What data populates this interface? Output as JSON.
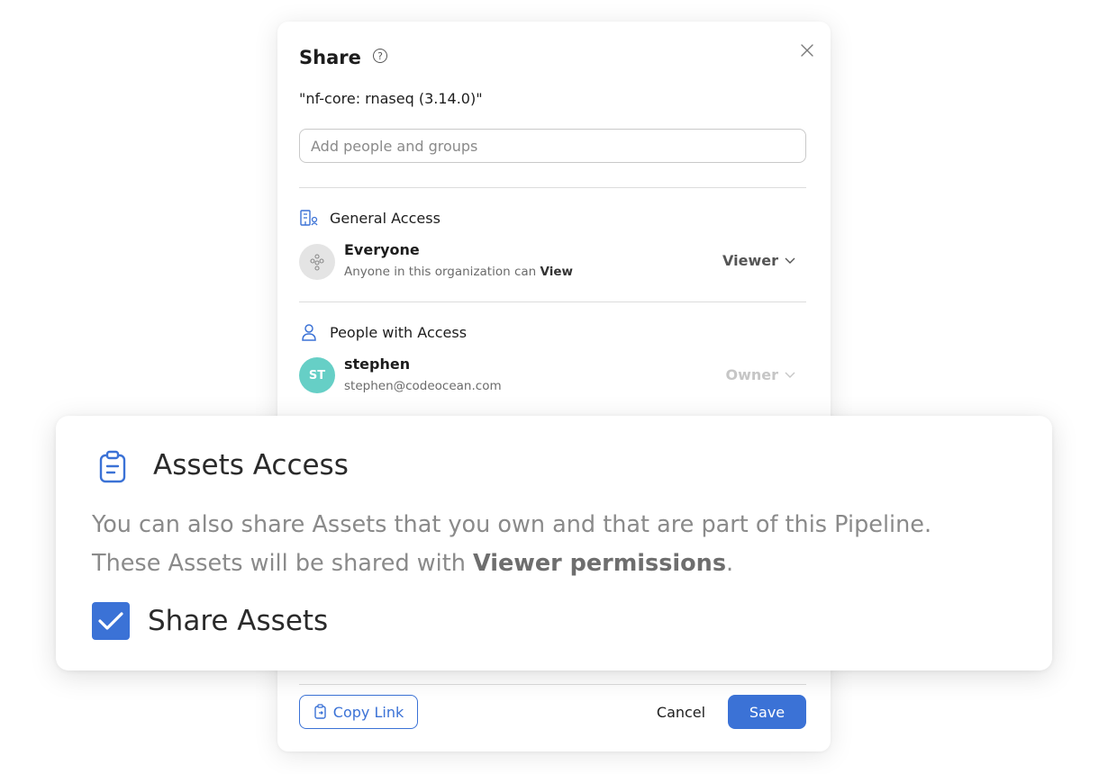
{
  "dialog": {
    "title": "Share",
    "item_name": "\"nf-core: rnaseq (3.14.0)\"",
    "add_placeholder": "Add people and groups",
    "general_access": {
      "heading": "General Access",
      "name": "Everyone",
      "desc_prefix": "Anyone in this organization can ",
      "desc_strong": "View",
      "role": "Viewer"
    },
    "people_access": {
      "heading": "People with Access",
      "avatar_initials": "ST",
      "name": "stephen",
      "email": "stephen@codeocean.com",
      "role": "Owner"
    },
    "footer": {
      "copy_link": "Copy Link",
      "cancel": "Cancel",
      "save": "Save"
    }
  },
  "assets": {
    "title": "Assets Access",
    "desc_line1": "You can also share Assets that you own and that are part of this Pipeline.",
    "desc_line2_prefix": "These Assets will be shared with ",
    "desc_strong": "Viewer permissions",
    "desc_suffix": ".",
    "checkbox_label": "Share Assets",
    "checked": true
  },
  "colors": {
    "accent": "#3b72d6",
    "avatar_teal": "#66cfc6"
  },
  "icons": {
    "help": "question-circle-icon",
    "close": "close-icon",
    "general_access": "building-icon",
    "people": "user-icon",
    "everyone": "group-icon",
    "assets": "clipboard-icon",
    "copy": "copy-link-icon",
    "role_dropdown": "chevron-down-icon",
    "check": "checkmark-icon"
  }
}
